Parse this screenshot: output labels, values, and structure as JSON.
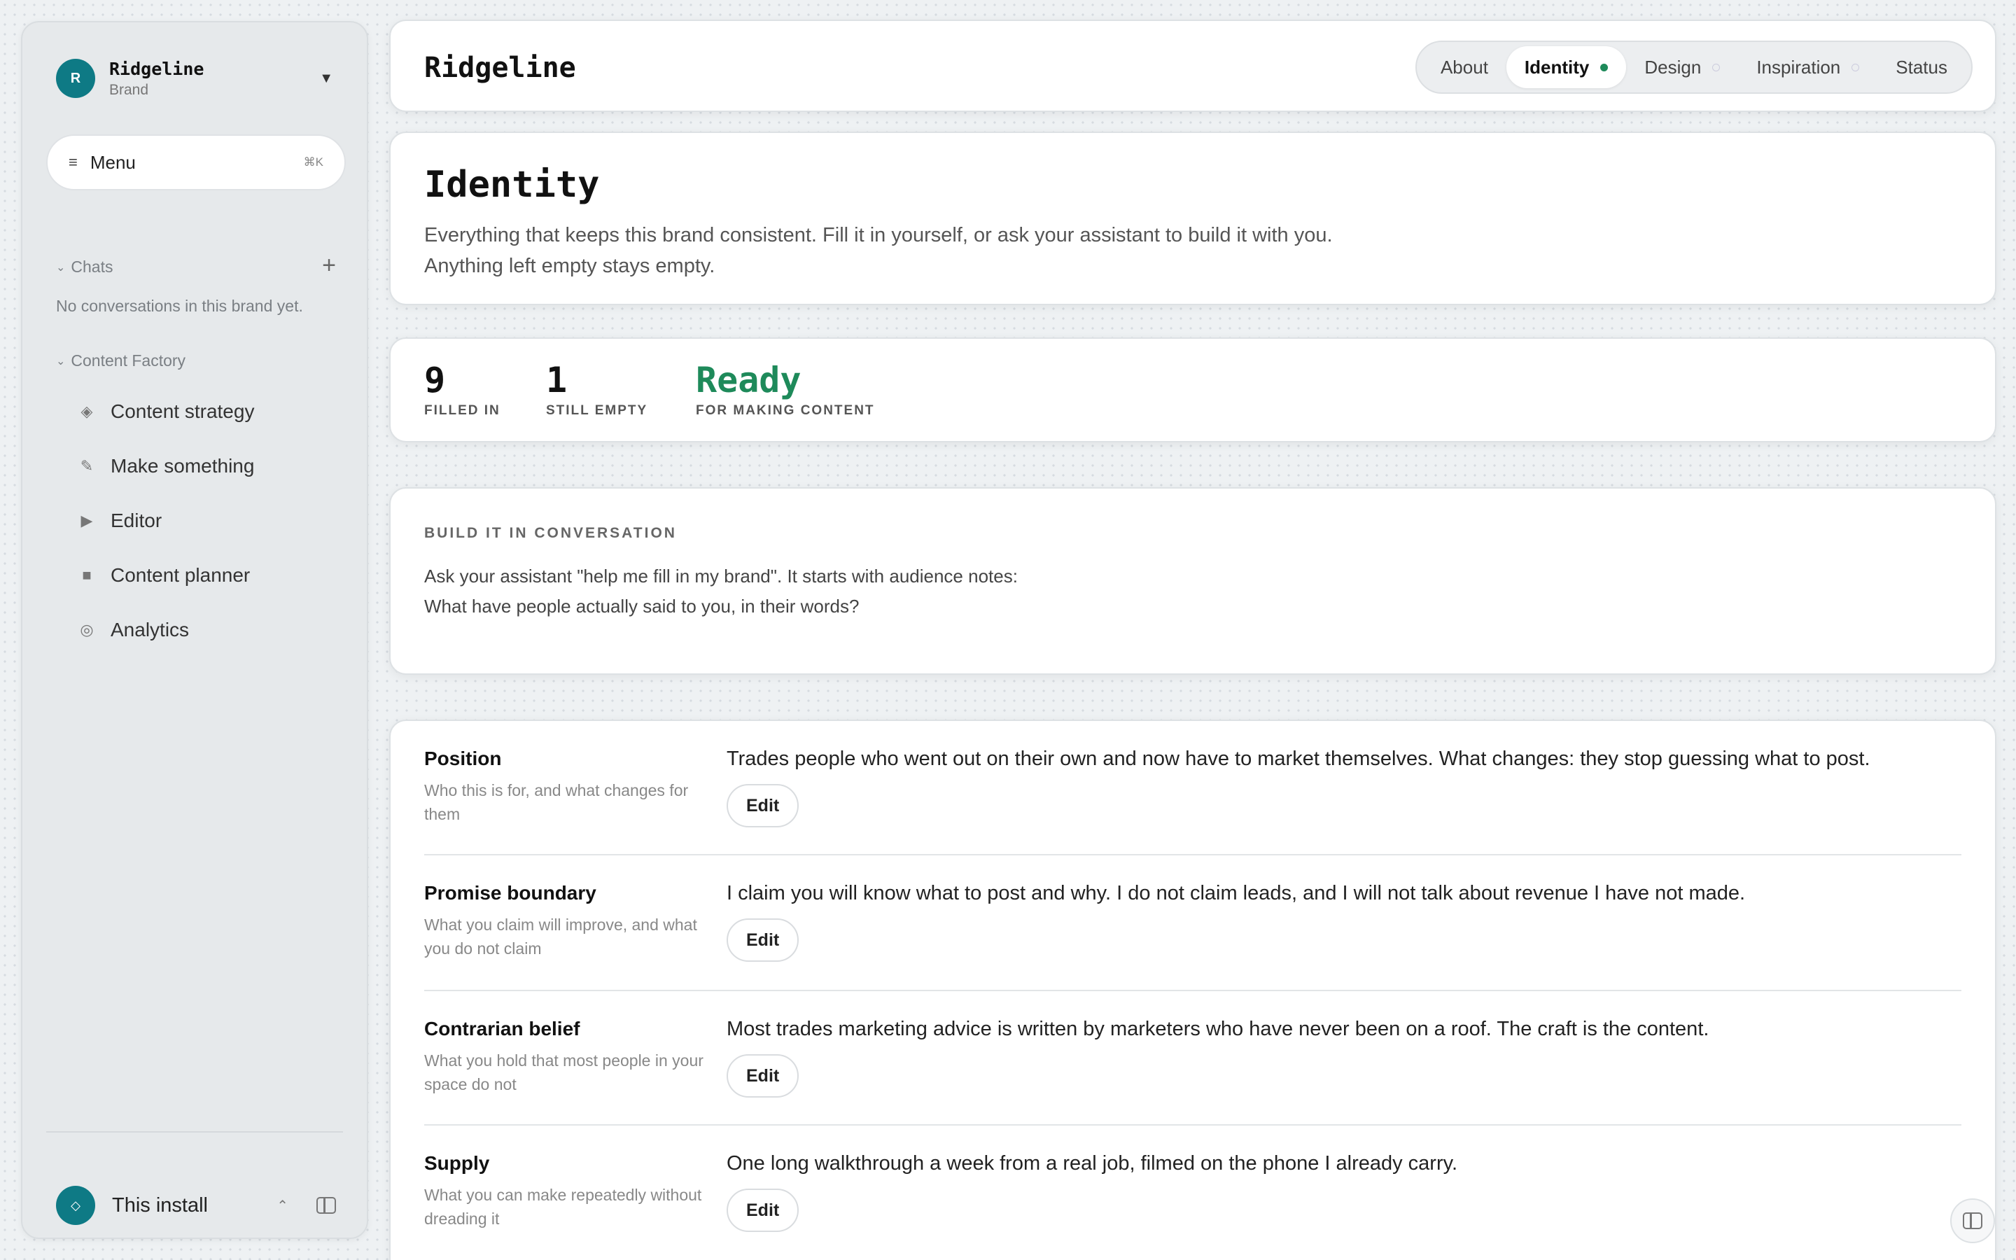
{
  "brand": {
    "initial": "R",
    "name": "Ridgeline",
    "subtitle": "Brand"
  },
  "menu": {
    "label": "Menu",
    "shortcut": "⌘K"
  },
  "chats": {
    "heading": "Chats",
    "empty": "No conversations in this brand yet."
  },
  "content_factory": {
    "heading": "Content Factory",
    "items": [
      {
        "label": "Content strategy",
        "icon": "diamond-icon"
      },
      {
        "label": "Make something",
        "icon": "pencil-icon"
      },
      {
        "label": "Editor",
        "icon": "play-icon"
      },
      {
        "label": "Content planner",
        "icon": "square-icon"
      },
      {
        "label": "Analytics",
        "icon": "circle-icon"
      }
    ]
  },
  "install": {
    "label": "This install",
    "icon_glyph": "◇"
  },
  "header": {
    "title": "Ridgeline",
    "tabs": [
      {
        "label": "About",
        "state": "none"
      },
      {
        "label": "Identity",
        "state": "active"
      },
      {
        "label": "Design",
        "state": "empty"
      },
      {
        "label": "Inspiration",
        "state": "empty"
      },
      {
        "label": "Status",
        "state": "none"
      }
    ]
  },
  "identity": {
    "title": "Identity",
    "description_line1": "Everything that keeps this brand consistent. Fill it in yourself, or ask your assistant to build it with you.",
    "description_line2": "Anything left empty stays empty."
  },
  "stats": [
    {
      "value": "9",
      "label": "FILLED IN"
    },
    {
      "value": "1",
      "label": "STILL EMPTY"
    },
    {
      "value": "Ready",
      "label": "FOR MAKING CONTENT"
    }
  ],
  "conversation": {
    "heading": "BUILD IT IN CONVERSATION",
    "line1": "Ask your assistant \"help me fill in my brand\". It starts with audience notes:",
    "line2": "What have people actually said to you, in their words?"
  },
  "fields": [
    {
      "name": "Position",
      "description": "Who this is for, and what changes for them",
      "value": "Trades people who went out on their own and now have to market themselves. What changes: they stop guessing what to post.",
      "edit_label": "Edit"
    },
    {
      "name": "Promise boundary",
      "description": "What you claim will improve, and what you do not claim",
      "value": "I claim you will know what to post and why. I do not claim leads, and I will not talk about revenue I have not made.",
      "edit_label": "Edit"
    },
    {
      "name": "Contrarian belief",
      "description": "What you hold that most people in your space do not",
      "value": "Most trades marketing advice is written by marketers who have never been on a roof. The craft is the content.",
      "edit_label": "Edit"
    },
    {
      "name": "Supply",
      "description": "What you can make repeatedly without dreading it",
      "value": "One long walkthrough a week from a real job, filmed on the phone I already carry.",
      "edit_label": "Edit"
    }
  ],
  "colors": {
    "accent": "#0e7a85",
    "ready": "#1e8a5a",
    "background": "#eef1f3"
  }
}
